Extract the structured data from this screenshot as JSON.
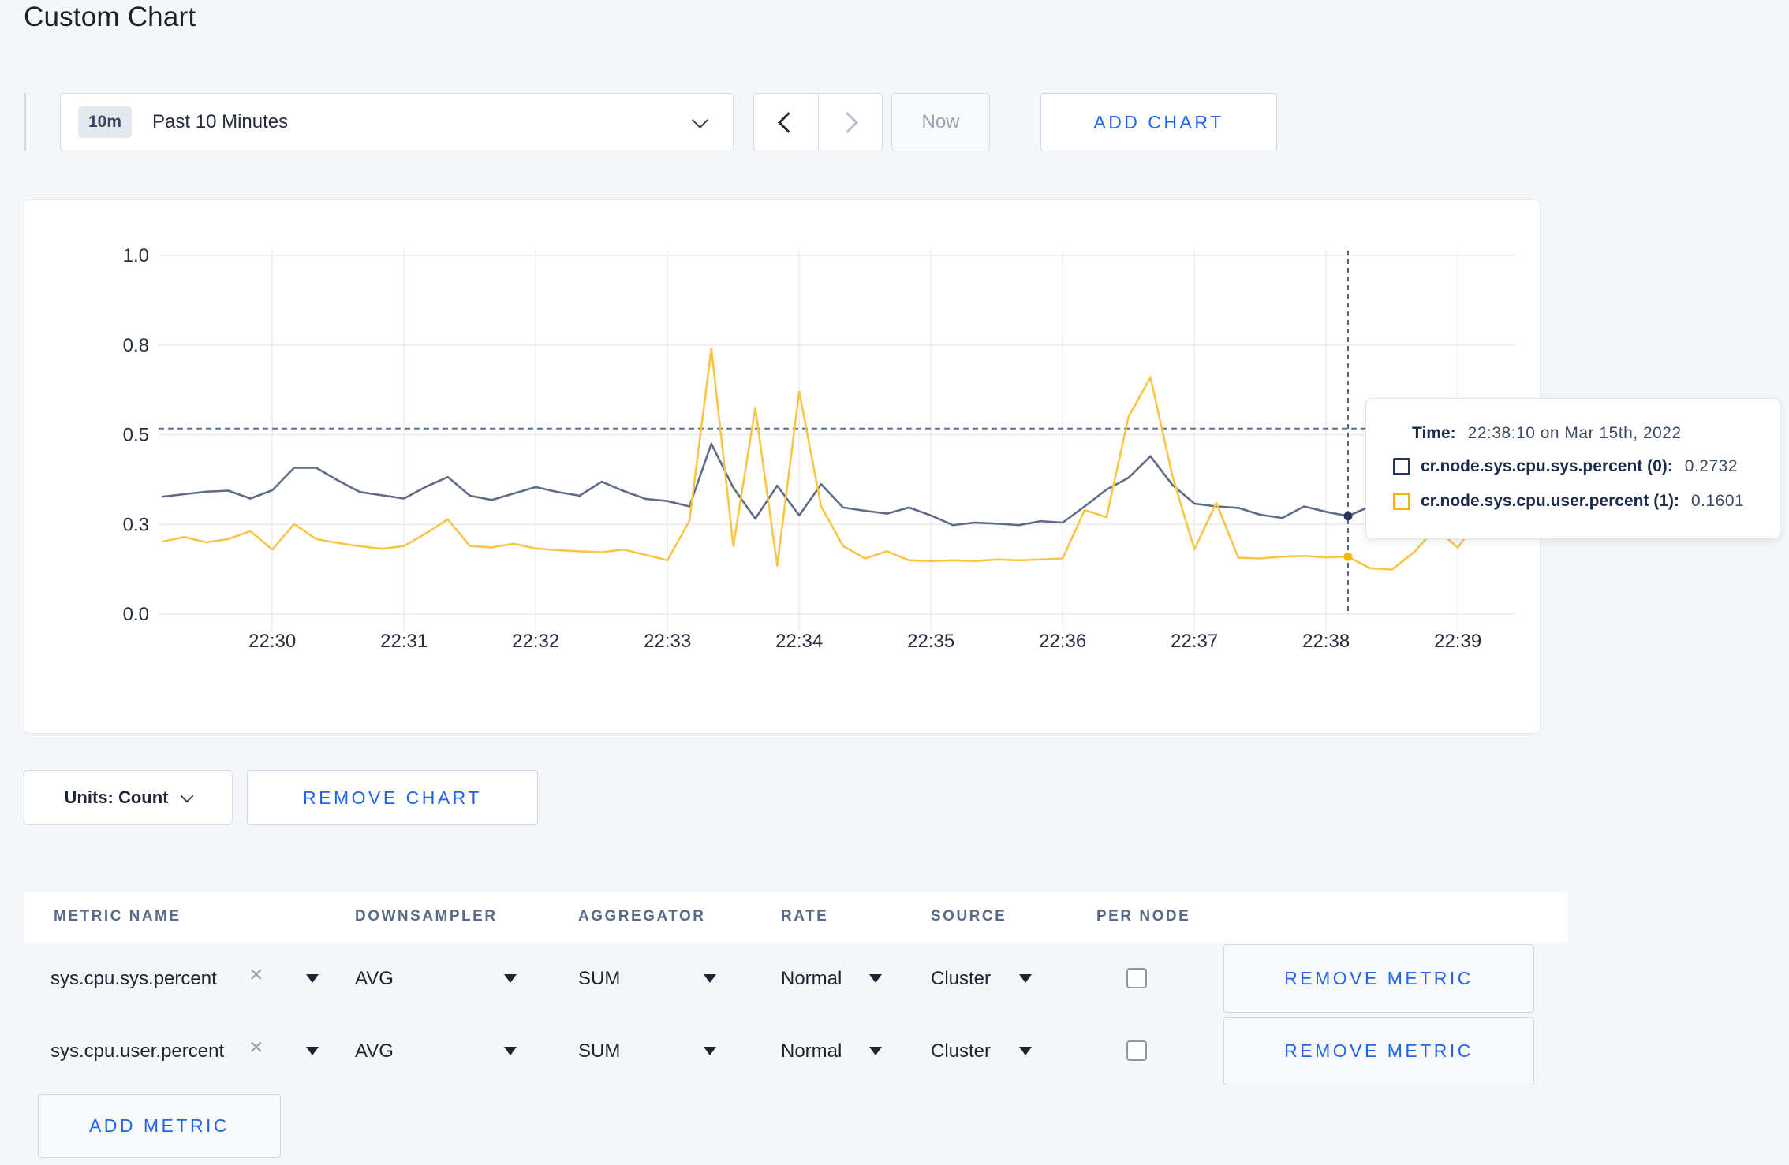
{
  "header": {
    "title": "Custom Chart"
  },
  "toolbar": {
    "range_badge": "10m",
    "range_label": "Past 10 Minutes",
    "now_label": "Now",
    "add_chart_label": "ADD CHART"
  },
  "chart_data": {
    "type": "line",
    "title": "",
    "xlabel": "",
    "ylabel": "",
    "ylim": [
      0,
      1
    ],
    "grid": true,
    "start_time": "22:29:10",
    "interval_seconds": 10,
    "x_tick_labels": [
      "22:30",
      "22:31",
      "22:32",
      "22:33",
      "22:34",
      "22:35",
      "22:36",
      "22:37",
      "22:38",
      "22:39"
    ],
    "y_tick_labels": [
      "0.0",
      "0.3",
      "0.5",
      "0.8",
      "1.0"
    ],
    "y_tick_values": [
      0,
      0.25,
      0.5,
      0.75,
      1.0
    ],
    "series": [
      {
        "name": "cr.node.sys.cpu.sys.percent",
        "color": "#5F6C87",
        "swatch": "#25355C",
        "values": [
          0.327,
          0.334,
          0.341,
          0.344,
          0.322,
          0.345,
          0.408,
          0.408,
          0.372,
          0.34,
          0.331,
          0.322,
          0.355,
          0.382,
          0.33,
          0.318,
          0.336,
          0.354,
          0.34,
          0.33,
          0.369,
          0.343,
          0.321,
          0.315,
          0.3,
          0.475,
          0.352,
          0.266,
          0.358,
          0.275,
          0.362,
          0.297,
          0.288,
          0.28,
          0.297,
          0.275,
          0.248,
          0.255,
          0.252,
          0.248,
          0.259,
          0.255,
          0.3,
          0.347,
          0.38,
          0.44,
          0.36,
          0.308,
          0.3,
          0.296,
          0.277,
          0.268,
          0.3,
          0.285,
          0.2732,
          0.3,
          0.285,
          0.305,
          0.29,
          0.29,
          0.28
        ]
      },
      {
        "name": "cr.node.sys.cpu.user.percent",
        "color": "#F8C647",
        "swatch": "#F2B600",
        "values": [
          0.202,
          0.215,
          0.2,
          0.209,
          0.231,
          0.18,
          0.251,
          0.209,
          0.198,
          0.189,
          0.182,
          0.19,
          0.225,
          0.264,
          0.19,
          0.186,
          0.196,
          0.183,
          0.178,
          0.175,
          0.172,
          0.18,
          0.165,
          0.15,
          0.26,
          0.74,
          0.19,
          0.575,
          0.135,
          0.62,
          0.3,
          0.19,
          0.155,
          0.175,
          0.15,
          0.148,
          0.15,
          0.148,
          0.152,
          0.15,
          0.152,
          0.155,
          0.29,
          0.27,
          0.55,
          0.66,
          0.385,
          0.18,
          0.31,
          0.157,
          0.155,
          0.16,
          0.162,
          0.158,
          0.1601,
          0.128,
          0.124,
          0.172,
          0.24,
          0.185,
          0.27
        ]
      }
    ],
    "hover": {
      "index": 54,
      "guideline_value": 0.517
    },
    "legend_position": "tooltip"
  },
  "tooltip": {
    "time_label": "Time:",
    "time_value": "22:38:10 on Mar 15th, 2022",
    "rows": [
      {
        "label": "cr.node.sys.cpu.sys.percent (0):",
        "value": "0.2732"
      },
      {
        "label": "cr.node.sys.cpu.user.percent (1):",
        "value": "0.1601"
      }
    ]
  },
  "units": {
    "label": "Units: Count",
    "remove_chart_label": "REMOVE CHART"
  },
  "metrics": {
    "columns": [
      "METRIC NAME",
      "DOWNSAMPLER",
      "AGGREGATOR",
      "RATE",
      "SOURCE",
      "PER NODE"
    ],
    "rows": [
      {
        "name": "sys.cpu.sys.percent",
        "downsampler": "AVG",
        "aggregator": "SUM",
        "rate": "Normal",
        "source": "Cluster",
        "per_node": false,
        "remove_label": "REMOVE METRIC"
      },
      {
        "name": "sys.cpu.user.percent",
        "downsampler": "AVG",
        "aggregator": "SUM",
        "rate": "Normal",
        "source": "Cluster",
        "per_node": false,
        "remove_label": "REMOVE METRIC"
      }
    ],
    "add_metric_label": "ADD METRIC"
  }
}
